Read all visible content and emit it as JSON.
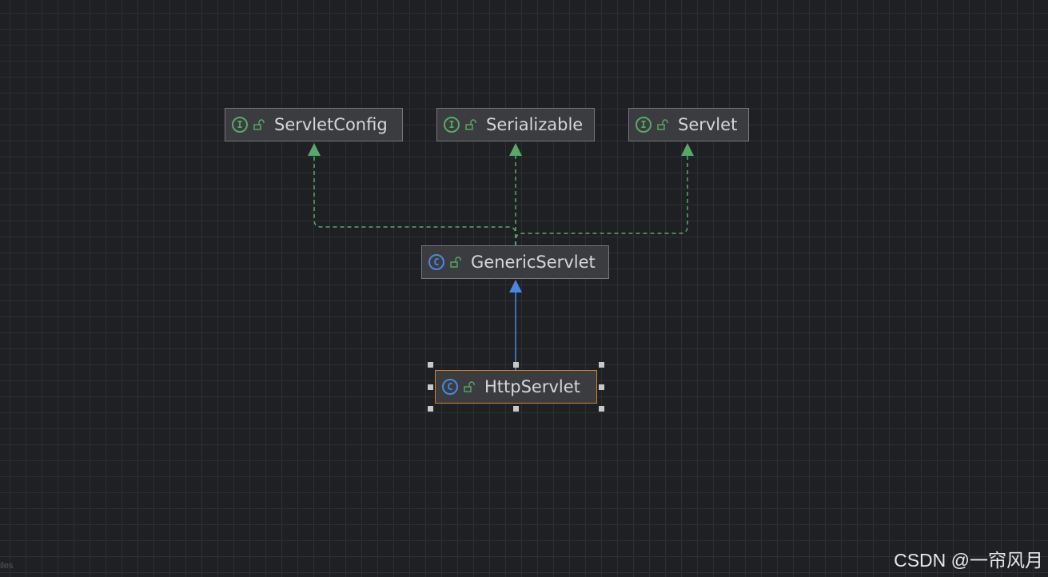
{
  "diagram": {
    "nodes": [
      {
        "id": "servlet-config",
        "label": "ServletConfig",
        "kind": "interface",
        "kind_letter": "I",
        "icon": "interface-icon"
      },
      {
        "id": "serializable",
        "label": "Serializable",
        "kind": "interface",
        "kind_letter": "I",
        "icon": "interface-icon"
      },
      {
        "id": "servlet",
        "label": "Servlet",
        "kind": "interface",
        "kind_letter": "I",
        "icon": "interface-icon"
      },
      {
        "id": "generic-servlet",
        "label": "GenericServlet",
        "kind": "class",
        "kind_letter": "C",
        "icon": "class-icon"
      },
      {
        "id": "http-servlet",
        "label": "HttpServlet",
        "kind": "class",
        "kind_letter": "C",
        "icon": "class-icon",
        "selected": true
      }
    ],
    "edges": [
      {
        "from": "generic-servlet",
        "to": "servlet-config",
        "type": "implements"
      },
      {
        "from": "generic-servlet",
        "to": "serializable",
        "type": "implements"
      },
      {
        "from": "generic-servlet",
        "to": "servlet",
        "type": "implements"
      },
      {
        "from": "http-servlet",
        "to": "generic-servlet",
        "type": "extends"
      }
    ],
    "colors": {
      "implements": "#59a869",
      "extends": "#4a88e0",
      "selection_border": "#d1812f",
      "lock_icon": "#59a869"
    }
  },
  "watermark": "CSDN @一帘风月",
  "corner_text": "iles"
}
